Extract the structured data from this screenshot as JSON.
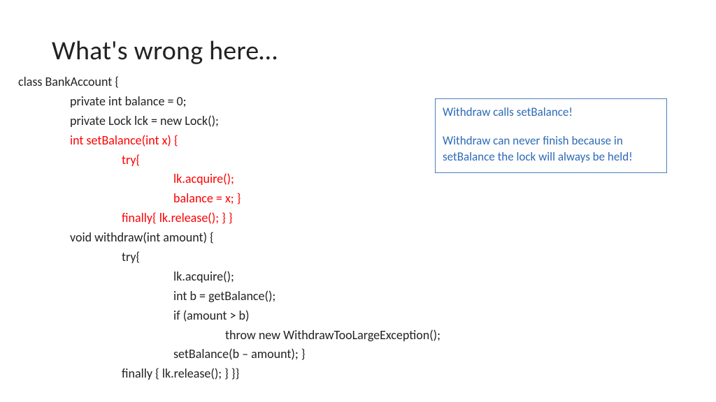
{
  "title": "What's wrong here…",
  "code": {
    "l0": "class BankAccount {",
    "l1": "private int balance = 0;",
    "l2": "private Lock lck = new Lock();",
    "l3": "int setBalance(int x) {",
    "l4": "try{",
    "l5": "lk.acquire();",
    "l6": "balance = x; }",
    "l7": "finally{ lk.release(); } }",
    "l8": "void withdraw(int amount) {",
    "l9": "try{",
    "l10": "lk.acquire();",
    "l11": "int b = getBalance();",
    "l12": "if (amount > b)",
    "l13": "throw new WithdrawTooLargeException();",
    "l14": "setBalance(b – amount); }",
    "l15": "finally { lk.release(); } }}"
  },
  "callout": {
    "line1": "Withdraw calls setBalance!",
    "line2": "Withdraw can never finish because in setBalance the lock will always be held!"
  }
}
